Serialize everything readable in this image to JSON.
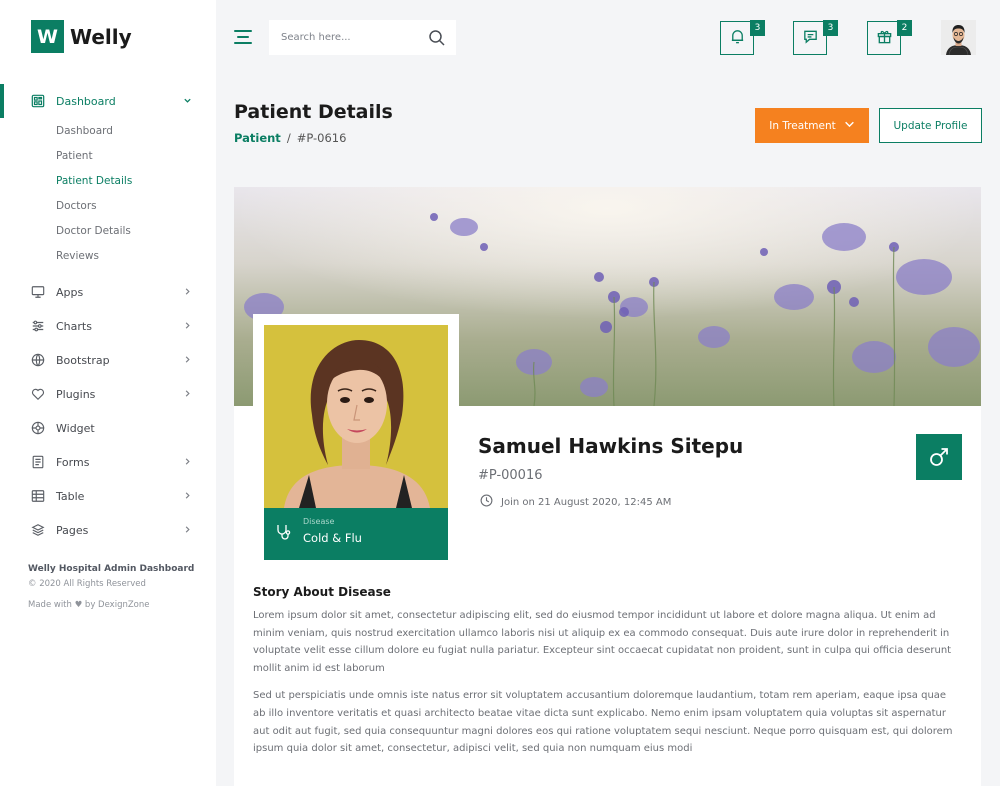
{
  "brand": {
    "logo_letter": "W",
    "name": "Welly"
  },
  "sidebar": {
    "items": [
      {
        "label": "Dashboard",
        "icon": "dashboard-icon",
        "expanded": true
      },
      {
        "label": "Apps",
        "icon": "monitor-icon"
      },
      {
        "label": "Charts",
        "icon": "sliders-icon"
      },
      {
        "label": "Bootstrap",
        "icon": "globe-icon"
      },
      {
        "label": "Plugins",
        "icon": "heart-icon"
      },
      {
        "label": "Widget",
        "icon": "settings-icon"
      },
      {
        "label": "Forms",
        "icon": "form-icon"
      },
      {
        "label": "Table",
        "icon": "table-icon"
      },
      {
        "label": "Pages",
        "icon": "layers-icon"
      }
    ],
    "submenu": [
      "Dashboard",
      "Patient",
      "Patient Details",
      "Doctors",
      "Doctor Details",
      "Reviews"
    ],
    "footer": {
      "title": "Welly Hospital Admin Dashboard",
      "copyright": "© 2020 All Rights Reserved",
      "made_with": "Made with ♥ by DexignZone"
    }
  },
  "header": {
    "search_placeholder": "Search here...",
    "notifications_count": "3",
    "messages_count": "3",
    "gifts_count": "2"
  },
  "page": {
    "title": "Patient Details",
    "breadcrumb_link": "Patient",
    "breadcrumb_sep": "/",
    "breadcrumb_current": "#P-0616",
    "status_button": "In Treatment",
    "update_button": "Update Profile"
  },
  "patient": {
    "name": "Samuel Hawkins Sitepu",
    "id": "#P-00016",
    "joined": "Join on 21 August 2020, 12:45 AM",
    "disease_label": "Disease",
    "disease": "Cold & Flu",
    "gender_icon": "male-icon"
  },
  "story": {
    "title": "Story About Disease",
    "paragraphs": [
      "Lorem ipsum dolor sit amet, consectetur adipiscing elit, sed do eiusmod tempor incididunt ut labore et dolore magna aliqua. Ut enim ad minim veniam, quis nostrud exercitation ullamco laboris nisi ut aliquip ex ea commodo consequat. Duis aute irure dolor in reprehenderit in voluptate velit esse cillum dolore eu fugiat nulla pariatur. Excepteur sint occaecat cupidatat non proident, sunt in culpa qui officia deserunt mollit anim id est laborum",
      "Sed ut perspiciatis unde omnis iste natus error sit voluptatem accusantium doloremque laudantium, totam rem aperiam, eaque ipsa quae ab illo inventore veritatis et quasi architecto beatae vitae dicta sunt explicabo. Nemo enim ipsam voluptatem quia voluptas sit aspernatur aut odit aut fugit, sed quia consequuntur magni dolores eos qui ratione voluptatem sequi nesciunt. Neque porro quisquam est, qui dolorem ipsum quia dolor sit amet, consectetur, adipisci velit, sed quia non numquam eius modi"
    ]
  },
  "colors": {
    "primary": "#0b7e63",
    "accent": "#f5811f"
  }
}
